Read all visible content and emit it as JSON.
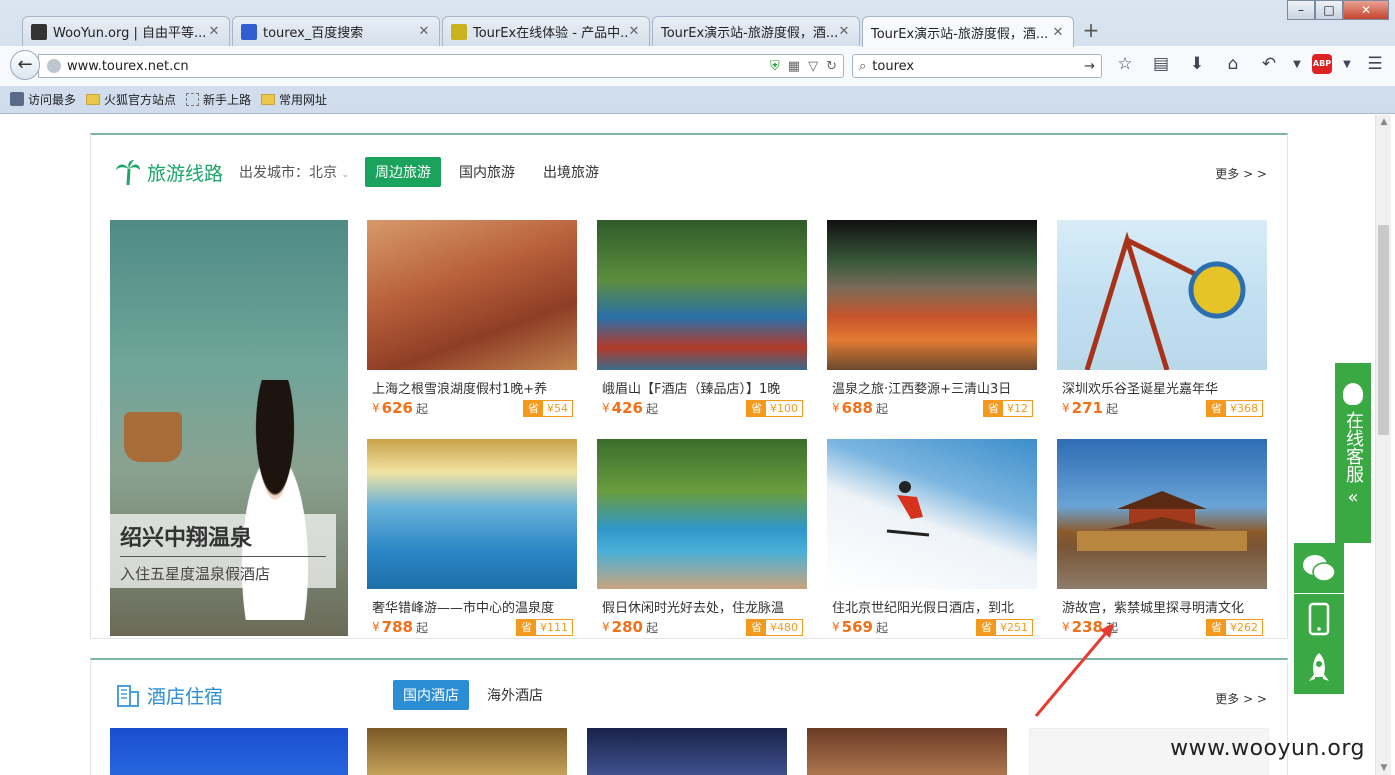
{
  "browser": {
    "tabs": [
      {
        "label": "WooYun.org | 自由平等...",
        "active": false,
        "icon": "wooyun-icon"
      },
      {
        "label": "tourex_百度搜索",
        "active": false,
        "icon": "baidu-paw-icon"
      },
      {
        "label": "TourEx在线体验 - 产品中...",
        "active": false,
        "icon": "tourex-icon"
      },
      {
        "label": "TourEx演示站-旅游度假，酒...",
        "active": false,
        "icon": ""
      },
      {
        "label": "TourEx演示站-旅游度假，酒...",
        "active": true,
        "icon": ""
      }
    ],
    "url": "www.tourex.net.cn",
    "search_value": "tourex",
    "bookmarks": [
      "访问最多",
      "火狐官方站点",
      "新手上路",
      "常用网址"
    ]
  },
  "travel": {
    "title": "旅游线路",
    "departure": "出发城市：北京",
    "tabs": [
      "周边旅游",
      "国内旅游",
      "出境旅游"
    ],
    "more": "更多 > >",
    "banner": {
      "title": "绍兴中翔温泉",
      "subtitle": "入住五星度温泉假酒店"
    },
    "products": [
      {
        "title": "上海之根雪浪湖度假村1晚+养",
        "yen": "¥",
        "price": "626",
        "qi": "起",
        "save_label": "省",
        "save": "¥54"
      },
      {
        "title": "峨眉山【F酒店（臻品店）】1晚",
        "yen": "¥",
        "price": "426",
        "qi": "起",
        "save_label": "省",
        "save": "¥100"
      },
      {
        "title": "温泉之旅·江西婺源+三清山3日",
        "yen": "¥",
        "price": "688",
        "qi": "起",
        "save_label": "省",
        "save": "¥12"
      },
      {
        "title": "深圳欢乐谷圣诞星光嘉年华",
        "yen": "¥",
        "price": "271",
        "qi": "起",
        "save_label": "省",
        "save": "¥368"
      },
      {
        "title": "奢华错峰游——市中心的温泉度",
        "yen": "¥",
        "price": "788",
        "qi": "起",
        "save_label": "省",
        "save": "¥111"
      },
      {
        "title": "假日休闲时光好去处，住龙脉温",
        "yen": "¥",
        "price": "280",
        "qi": "起",
        "save_label": "省",
        "save": "¥480"
      },
      {
        "title": "住北京世纪阳光假日酒店，到北",
        "yen": "¥",
        "price": "569",
        "qi": "起",
        "save_label": "省",
        "save": "¥251"
      },
      {
        "title": "游故宫，紫禁城里探寻明清文化",
        "yen": "¥",
        "price": "238",
        "qi": "起",
        "save_label": "省",
        "save": "¥262"
      }
    ]
  },
  "hotel": {
    "title": "酒店住宿",
    "tabs": [
      "国内酒店",
      "海外酒店"
    ],
    "more": "更多 > >"
  },
  "side": {
    "kefu_label": "在线客服",
    "kefu_arrow": "«"
  },
  "watermark": "www.wooyun.org",
  "colors": {
    "green": "#19a35c",
    "orange": "#f27018",
    "blue": "#2b8ed4"
  }
}
